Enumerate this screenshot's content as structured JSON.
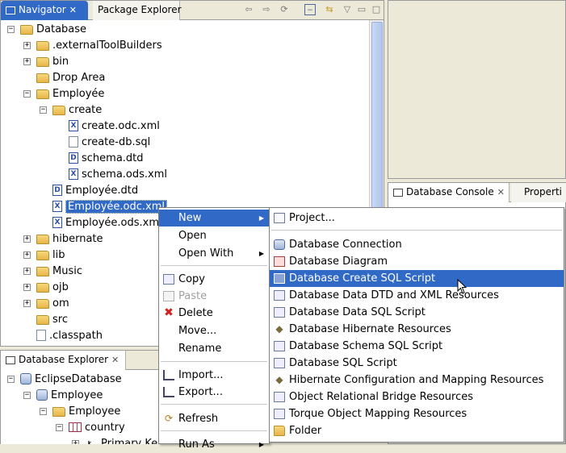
{
  "navigator": {
    "tabs": [
      {
        "label": "Navigator"
      },
      {
        "label": "Package Explorer"
      }
    ],
    "tree": [
      {
        "label": "Database"
      },
      {
        "label": ".externalToolBuilders"
      },
      {
        "label": "bin"
      },
      {
        "label": "Drop Area"
      },
      {
        "label": "Employée"
      },
      {
        "label": "create"
      },
      {
        "label": "create.odc.xml"
      },
      {
        "label": "create-db.sql"
      },
      {
        "label": "schema.dtd"
      },
      {
        "label": "schema.ods.xml"
      },
      {
        "label": "Employée.dtd"
      },
      {
        "label": "Employée.odc.xml"
      },
      {
        "label": "Employée.ods.xml"
      },
      {
        "label": "hibernate"
      },
      {
        "label": "lib"
      },
      {
        "label": "Music"
      },
      {
        "label": "ojb"
      },
      {
        "label": "om"
      },
      {
        "label": "src"
      },
      {
        "label": ".classpath"
      }
    ]
  },
  "console": {
    "tabs": [
      {
        "label": "Database Console"
      },
      {
        "label": "Properti"
      }
    ]
  },
  "explorer": {
    "tab": {
      "label": "Database Explorer"
    },
    "tree": [
      {
        "label": "EclipseDatabase"
      },
      {
        "label": "Employee"
      },
      {
        "label": "Employee"
      },
      {
        "label": "country"
      },
      {
        "label": "Primary Key"
      }
    ]
  },
  "context_menu": {
    "items": [
      {
        "label": "New"
      },
      {
        "label": "Open"
      },
      {
        "label": "Open With"
      },
      {
        "label": "Copy"
      },
      {
        "label": "Paste"
      },
      {
        "label": "Delete"
      },
      {
        "label": "Move..."
      },
      {
        "label": "Rename"
      },
      {
        "label": "Import..."
      },
      {
        "label": "Export..."
      },
      {
        "label": "Refresh"
      },
      {
        "label": "Run As"
      }
    ]
  },
  "submenu": {
    "items": [
      {
        "label": "Project..."
      },
      {
        "label": "Database Connection"
      },
      {
        "label": "Database Diagram"
      },
      {
        "label": "Database Create SQL Script"
      },
      {
        "label": "Database Data DTD and XML Resources"
      },
      {
        "label": "Database Data SQL Script"
      },
      {
        "label": "Database Hibernate Resources"
      },
      {
        "label": "Database Schema SQL Script"
      },
      {
        "label": "Database SQL Script"
      },
      {
        "label": "Hibernate Configuration and Mapping Resources"
      },
      {
        "label": "Object Relational Bridge Resources"
      },
      {
        "label": "Torque Object Mapping Resources"
      },
      {
        "label": "Folder"
      }
    ]
  },
  "colors": {
    "selection": "#3169c6",
    "folder": "#e8b54a"
  }
}
